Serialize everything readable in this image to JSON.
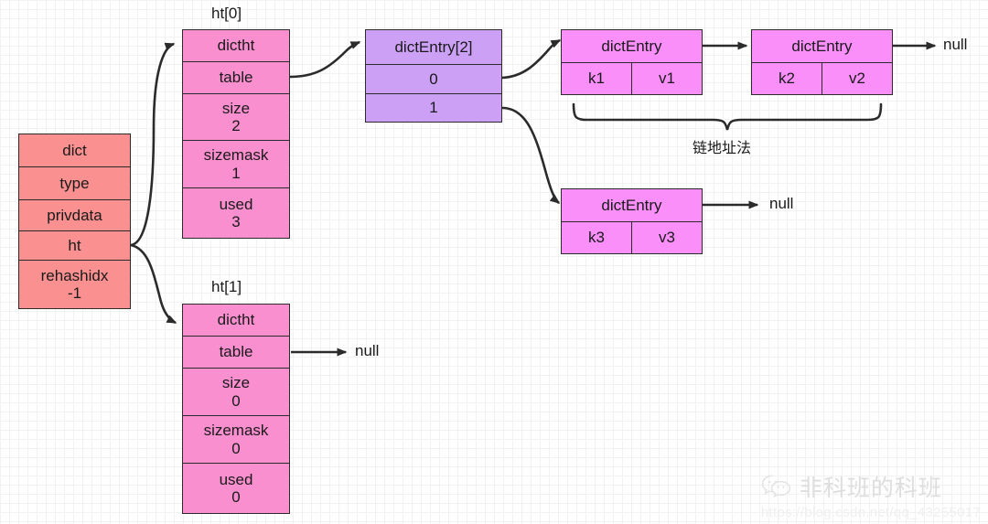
{
  "diagram": {
    "title": "Redis dict / dictht hash table structure",
    "colors": {
      "dict_fill": "#fa9090",
      "dictht_fill": "#fa8fd0",
      "bucket_fill": "#cba0f5",
      "entry_fill": "#fa8ffa",
      "stroke": "#2b2b2b",
      "grid": "#e8e8e8",
      "text": "#1a1a1a"
    },
    "dict": {
      "name": "dict",
      "rows": [
        {
          "label": "dict",
          "value": ""
        },
        {
          "label": "type",
          "value": ""
        },
        {
          "label": "privdata",
          "value": ""
        },
        {
          "label": "ht",
          "value": ""
        },
        {
          "label": "rehashidx",
          "value": "-1"
        }
      ]
    },
    "ht0": {
      "caption": "ht[0]",
      "rows": [
        {
          "label": "dictht",
          "value": ""
        },
        {
          "label": "table",
          "value": ""
        },
        {
          "label": "size",
          "value": "2"
        },
        {
          "label": "sizemask",
          "value": "1"
        },
        {
          "label": "used",
          "value": "3"
        }
      ]
    },
    "ht1": {
      "caption": "ht[1]",
      "rows": [
        {
          "label": "dictht",
          "value": ""
        },
        {
          "label": "table",
          "value": ""
        },
        {
          "label": "size",
          "value": "0"
        },
        {
          "label": "sizemask",
          "value": "0"
        },
        {
          "label": "used",
          "value": "0"
        }
      ],
      "null_label": "null"
    },
    "bucket_array": {
      "header": "dictEntry[2]",
      "slots": [
        "0",
        "1"
      ]
    },
    "entries": [
      {
        "id": "entry-k1",
        "header": "dictEntry",
        "key": "k1",
        "value": "v1"
      },
      {
        "id": "entry-k2",
        "header": "dictEntry",
        "key": "k2",
        "value": "v2"
      },
      {
        "id": "entry-k3",
        "header": "dictEntry",
        "key": "k3",
        "value": "v3"
      }
    ],
    "null_labels": {
      "chain0_end": "null",
      "chain1_end": "null"
    },
    "annotation": {
      "brace_label": "链地址法"
    }
  },
  "watermark": {
    "icon": "wechat-icon",
    "account_name": "非科班的科班",
    "url": "https://blog.csdn.net/qq_43255017"
  }
}
